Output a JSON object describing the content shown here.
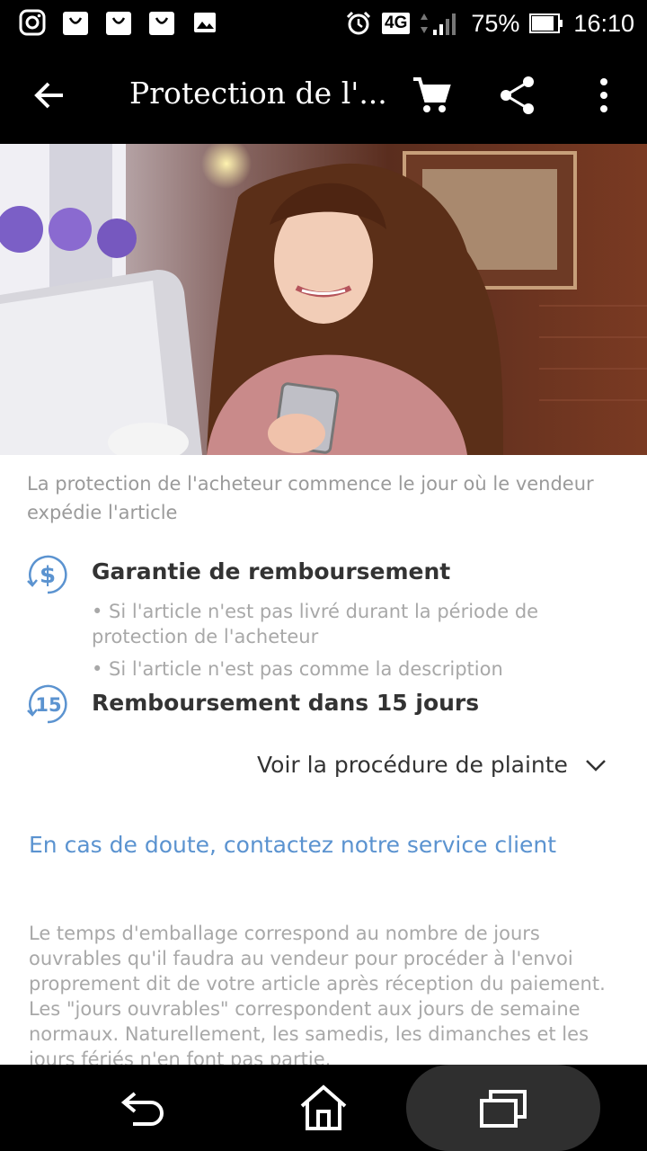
{
  "status_bar": {
    "battery": "75%",
    "network": "4G",
    "time": "16:10",
    "left_icons": [
      "instagram-icon",
      "shopping-bag-icon",
      "shopping-bag-icon",
      "shopping-bag-icon",
      "image-icon"
    ]
  },
  "app_bar": {
    "title": "Protection de l'...",
    "icons": [
      "back-arrow-icon",
      "cart-icon",
      "share-icon",
      "more-vert-icon"
    ]
  },
  "intro": "La protection de l'acheteur commence le jour où le vendeur expédie l'article",
  "features": [
    {
      "icon": "refund-dollar-icon",
      "icon_text": "$",
      "title": "Garantie de remboursement",
      "bullets": [
        "• Si l'article n'est pas livré durant la période de protection de l'acheteur",
        "• Si l'article n'est pas comme la description"
      ]
    },
    {
      "icon": "refund-15-icon",
      "icon_text": "15",
      "title": "Remboursement dans 15 jours",
      "bullets": []
    }
  ],
  "procedure_link": "Voir la procédure de plainte",
  "contact_link": "En cas de doute, contactez notre service client",
  "packaging_text": "Le temps d'emballage correspond au nombre de jours ouvrables qu'il faudra au vendeur pour procéder à l'envoi proprement dit de votre article après réception du paiement. Les \"jours ouvrables\" correspondent aux jours de semaine normaux. Naturellement, les samedis, les dimanches et les jours fériés n'en font pas partie.",
  "colors": {
    "accent": "#5b93d0",
    "bar_background": "#000000",
    "muted_text": "#a8a8a8"
  },
  "nav_bar": [
    "back-nav-icon",
    "home-nav-icon",
    "recents-nav-icon"
  ]
}
